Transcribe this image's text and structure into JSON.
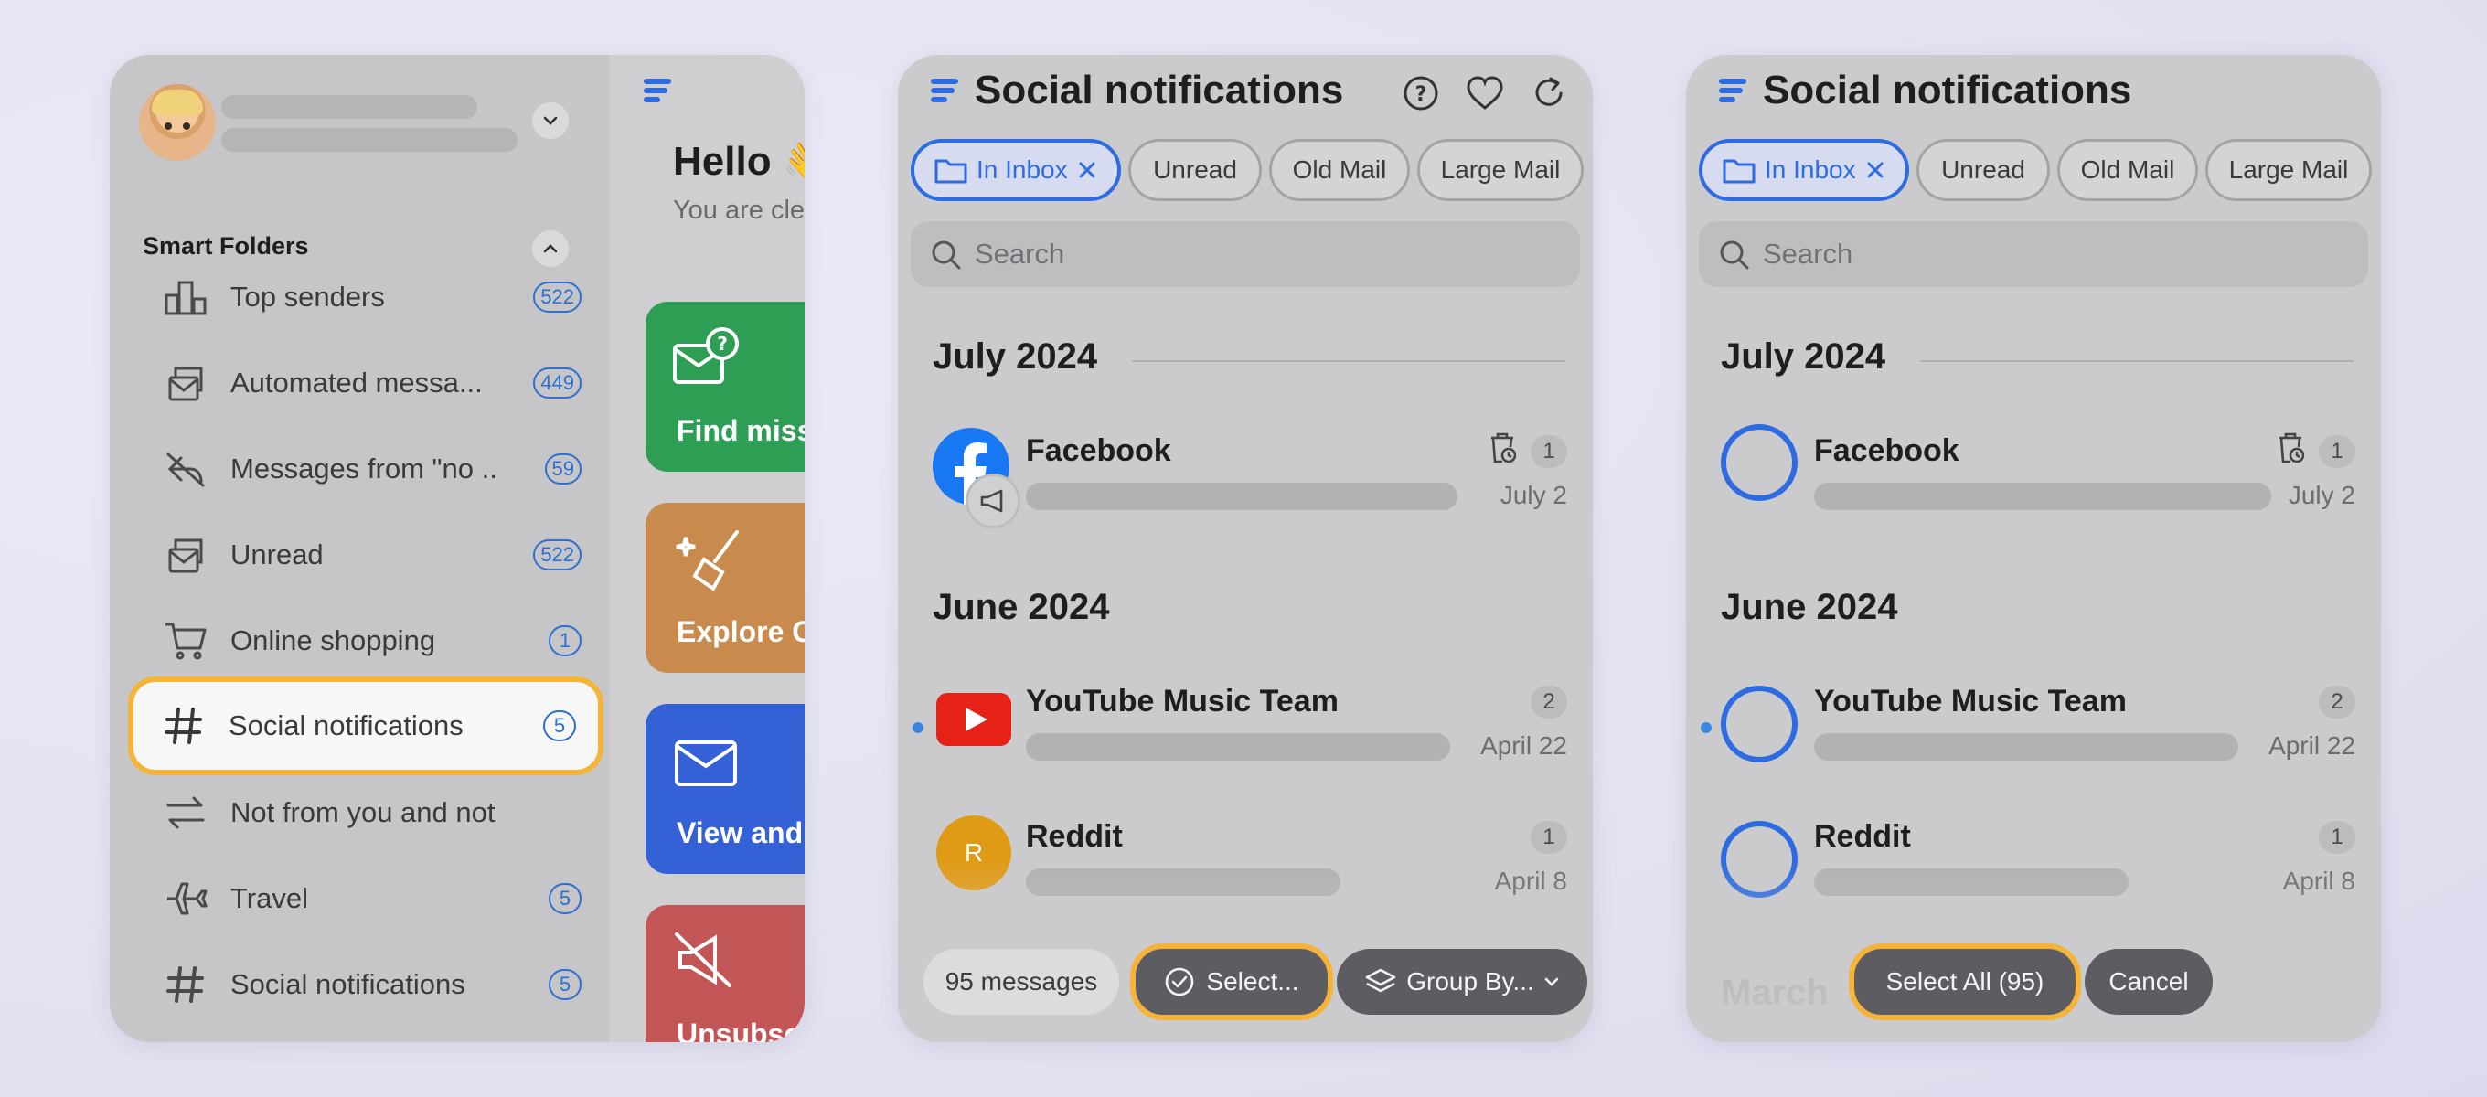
{
  "panel1": {
    "sidebar": {
      "section_title": "Smart Folders",
      "items": [
        {
          "label": "Top senders",
          "count": "522",
          "icon": "top-senders-icon"
        },
        {
          "label": "Automated messa...",
          "count": "449",
          "icon": "automated-icon"
        },
        {
          "label": "Messages from \"no ...",
          "count": "59",
          "icon": "no-reply-icon"
        },
        {
          "label": "Unread",
          "count": "522",
          "icon": "unread-icon"
        },
        {
          "label": "Online shopping",
          "count": "1",
          "icon": "cart-icon"
        },
        {
          "label": "Social notifications",
          "count": "5",
          "icon": "hashtag-icon"
        },
        {
          "label": "Not from you and not to ...",
          "count": "",
          "icon": "arrows-icon"
        },
        {
          "label": "Travel",
          "count": "5",
          "icon": "plane-icon"
        },
        {
          "label": "Social notifications",
          "count": "5",
          "icon": "hashtag-icon"
        }
      ]
    },
    "main": {
      "greeting": "Hello 👋",
      "subtitle": "You are cle",
      "cards": [
        {
          "label": "Find miss",
          "color": "#2f9e55"
        },
        {
          "label": "Explore C",
          "color": "#c98a4e"
        },
        {
          "label": "View and",
          "color": "#3461d6"
        },
        {
          "label": "Unsubsc",
          "color": "#c25555"
        }
      ]
    }
  },
  "panel2": {
    "title": "Social notifications",
    "chips": [
      "In Inbox",
      "Unread",
      "Old Mail",
      "Large Mail"
    ],
    "search_placeholder": "Search",
    "months": [
      "July 2024",
      "June 2024"
    ],
    "rows": [
      {
        "name": "Facebook",
        "count": "1",
        "date": "July 2",
        "unread": false
      },
      {
        "name": "YouTube Music Team",
        "count": "2",
        "date": "April 22",
        "unread": true
      },
      {
        "name": "Reddit",
        "count": "1",
        "date": "April 8",
        "unread": false,
        "avatar_letter": "R"
      }
    ],
    "footer": {
      "messages": "95 messages",
      "select": "Select...",
      "group_by": "Group By..."
    }
  },
  "panel3": {
    "title": "Social notifications",
    "chips": [
      "In Inbox",
      "Unread",
      "Old Mail",
      "Large Mail"
    ],
    "search_placeholder": "Search",
    "months": [
      "July 2024",
      "June 2024",
      "March"
    ],
    "rows": [
      {
        "name": "Facebook",
        "count": "1",
        "date": "July 2",
        "unread": false
      },
      {
        "name": "YouTube Music Team",
        "count": "2",
        "date": "April 22",
        "unread": true
      },
      {
        "name": "Reddit",
        "count": "1",
        "date": "April 8",
        "unread": false
      }
    ],
    "footer": {
      "select_all": "Select All (95)",
      "cancel": "Cancel"
    }
  },
  "colors": {
    "accent": "#2d6be0",
    "highlight": "#f4b43a",
    "facebook": "#1877f2",
    "youtube": "#e62117",
    "reddit": "#e09b16"
  }
}
